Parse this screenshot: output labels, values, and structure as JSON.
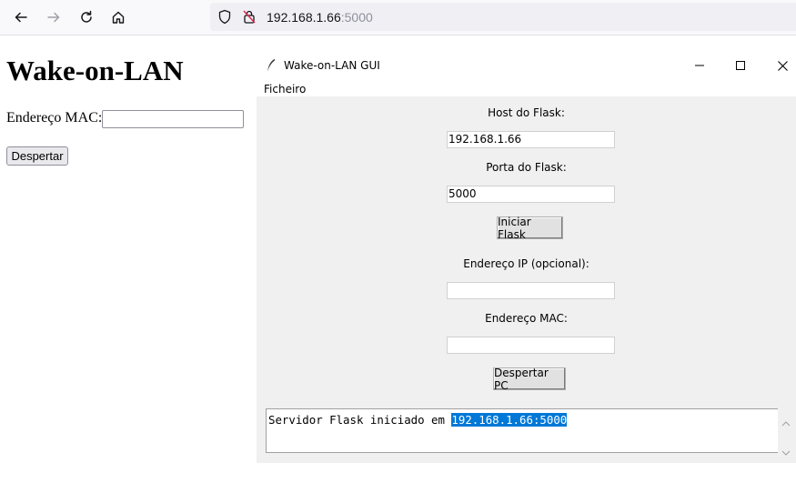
{
  "browser": {
    "url_host": "192.168.1.66",
    "url_port": ":5000"
  },
  "page": {
    "title": "Wake-on-LAN",
    "mac_label": "Endereço MAC:",
    "mac_value": "",
    "wake_button": "Despertar"
  },
  "tk_window": {
    "title": "Wake-on-LAN GUI",
    "menu": [
      "Ficheiro"
    ],
    "host_label": "Host do Flask:",
    "host_value": "192.168.1.66",
    "port_label": "Porta do Flask:",
    "port_value": "5000",
    "start_button": "Iniciar Flask",
    "ip_label": "Endereço IP (opcional):",
    "ip_value": "",
    "mac_label": "Endereço MAC:",
    "mac_value": "",
    "wake_button": "Despertar PC",
    "log_prefix": "Servidor Flask iniciado em ",
    "log_selected": "192.168.1.66:5000"
  }
}
